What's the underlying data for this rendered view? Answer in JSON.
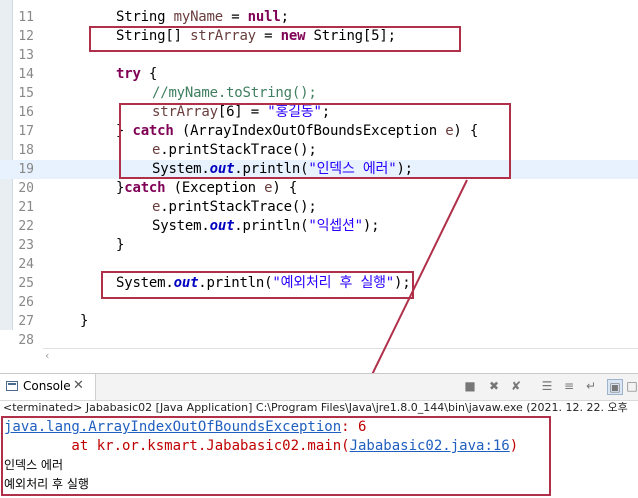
{
  "editor": {
    "line_numbers": [
      "11",
      "12",
      "13",
      "14",
      "15",
      "16",
      "17",
      "18",
      "19",
      "20",
      "21",
      "22",
      "23",
      "24",
      "25",
      "26",
      "27",
      "28"
    ],
    "l11": {
      "type": "String",
      "var": "myName",
      "eq": " = ",
      "kw": "null",
      "end": ";"
    },
    "l12": {
      "type": "String[]",
      "var": "strArray",
      "eq": " = ",
      "kw": "new",
      "rest": " String[5];"
    },
    "l14": {
      "kw": "try",
      "rest": " {"
    },
    "l15": {
      "comment": "//myName.toString();"
    },
    "l16": {
      "var": "strArray",
      "mid": "[6] = ",
      "str": "\"홍길동\"",
      "end": ";"
    },
    "l17": {
      "open": "} ",
      "kw": "catch",
      "mid": " (ArrayIndexOutOfBoundsException ",
      "var": "e",
      "end": ") {"
    },
    "l18": {
      "var": "e",
      "rest": ".printStackTrace();"
    },
    "l19": {
      "pre": "System.",
      "fld": "out",
      "mid": ".println(",
      "str": "\"인덱스 에러\"",
      "end": ");"
    },
    "l20": {
      "open": "}",
      "kw": "catch",
      "mid": " (Exception ",
      "var": "e",
      "end": ") {"
    },
    "l21": {
      "var": "e",
      "rest": ".printStackTrace();"
    },
    "l22": {
      "pre": "System.",
      "fld": "out",
      "mid": ".println(",
      "str": "\"익셉션\"",
      "end": ");"
    },
    "l23": {
      "text": "}"
    },
    "l25": {
      "pre": "System.",
      "fld": "out",
      "mid": ".println(",
      "str": "\"예외처리 후 실행\"",
      "end": ");"
    },
    "l27": {
      "text": "}"
    }
  },
  "console": {
    "tab_label": "Console",
    "close_glyph": "✕",
    "status": "<terminated> Jababasic02 [Java Application] C:\\Program Files\\Java\\jre1.8.0_144\\bin\\javaw.exe (2021. 12. 22. 오후",
    "exception_class": "java.lang.ArrayIndexOutOfBoundsException",
    "exception_value": ": 6",
    "trace_prefix": "        at kr.or.ksmart.Jababasic02.main(",
    "trace_link": "Jababasic02.java:16",
    "trace_suffix": ")",
    "out1": "인덱스 에러",
    "out2": "예외처리 후 실행"
  },
  "colors": {
    "annotation": "#b0304a",
    "keyword": "#7f0055",
    "string": "#2a00ff",
    "comment": "#3f7f5f",
    "field": "#0000c0",
    "error": "#c00000",
    "link": "#1f5fbf"
  }
}
